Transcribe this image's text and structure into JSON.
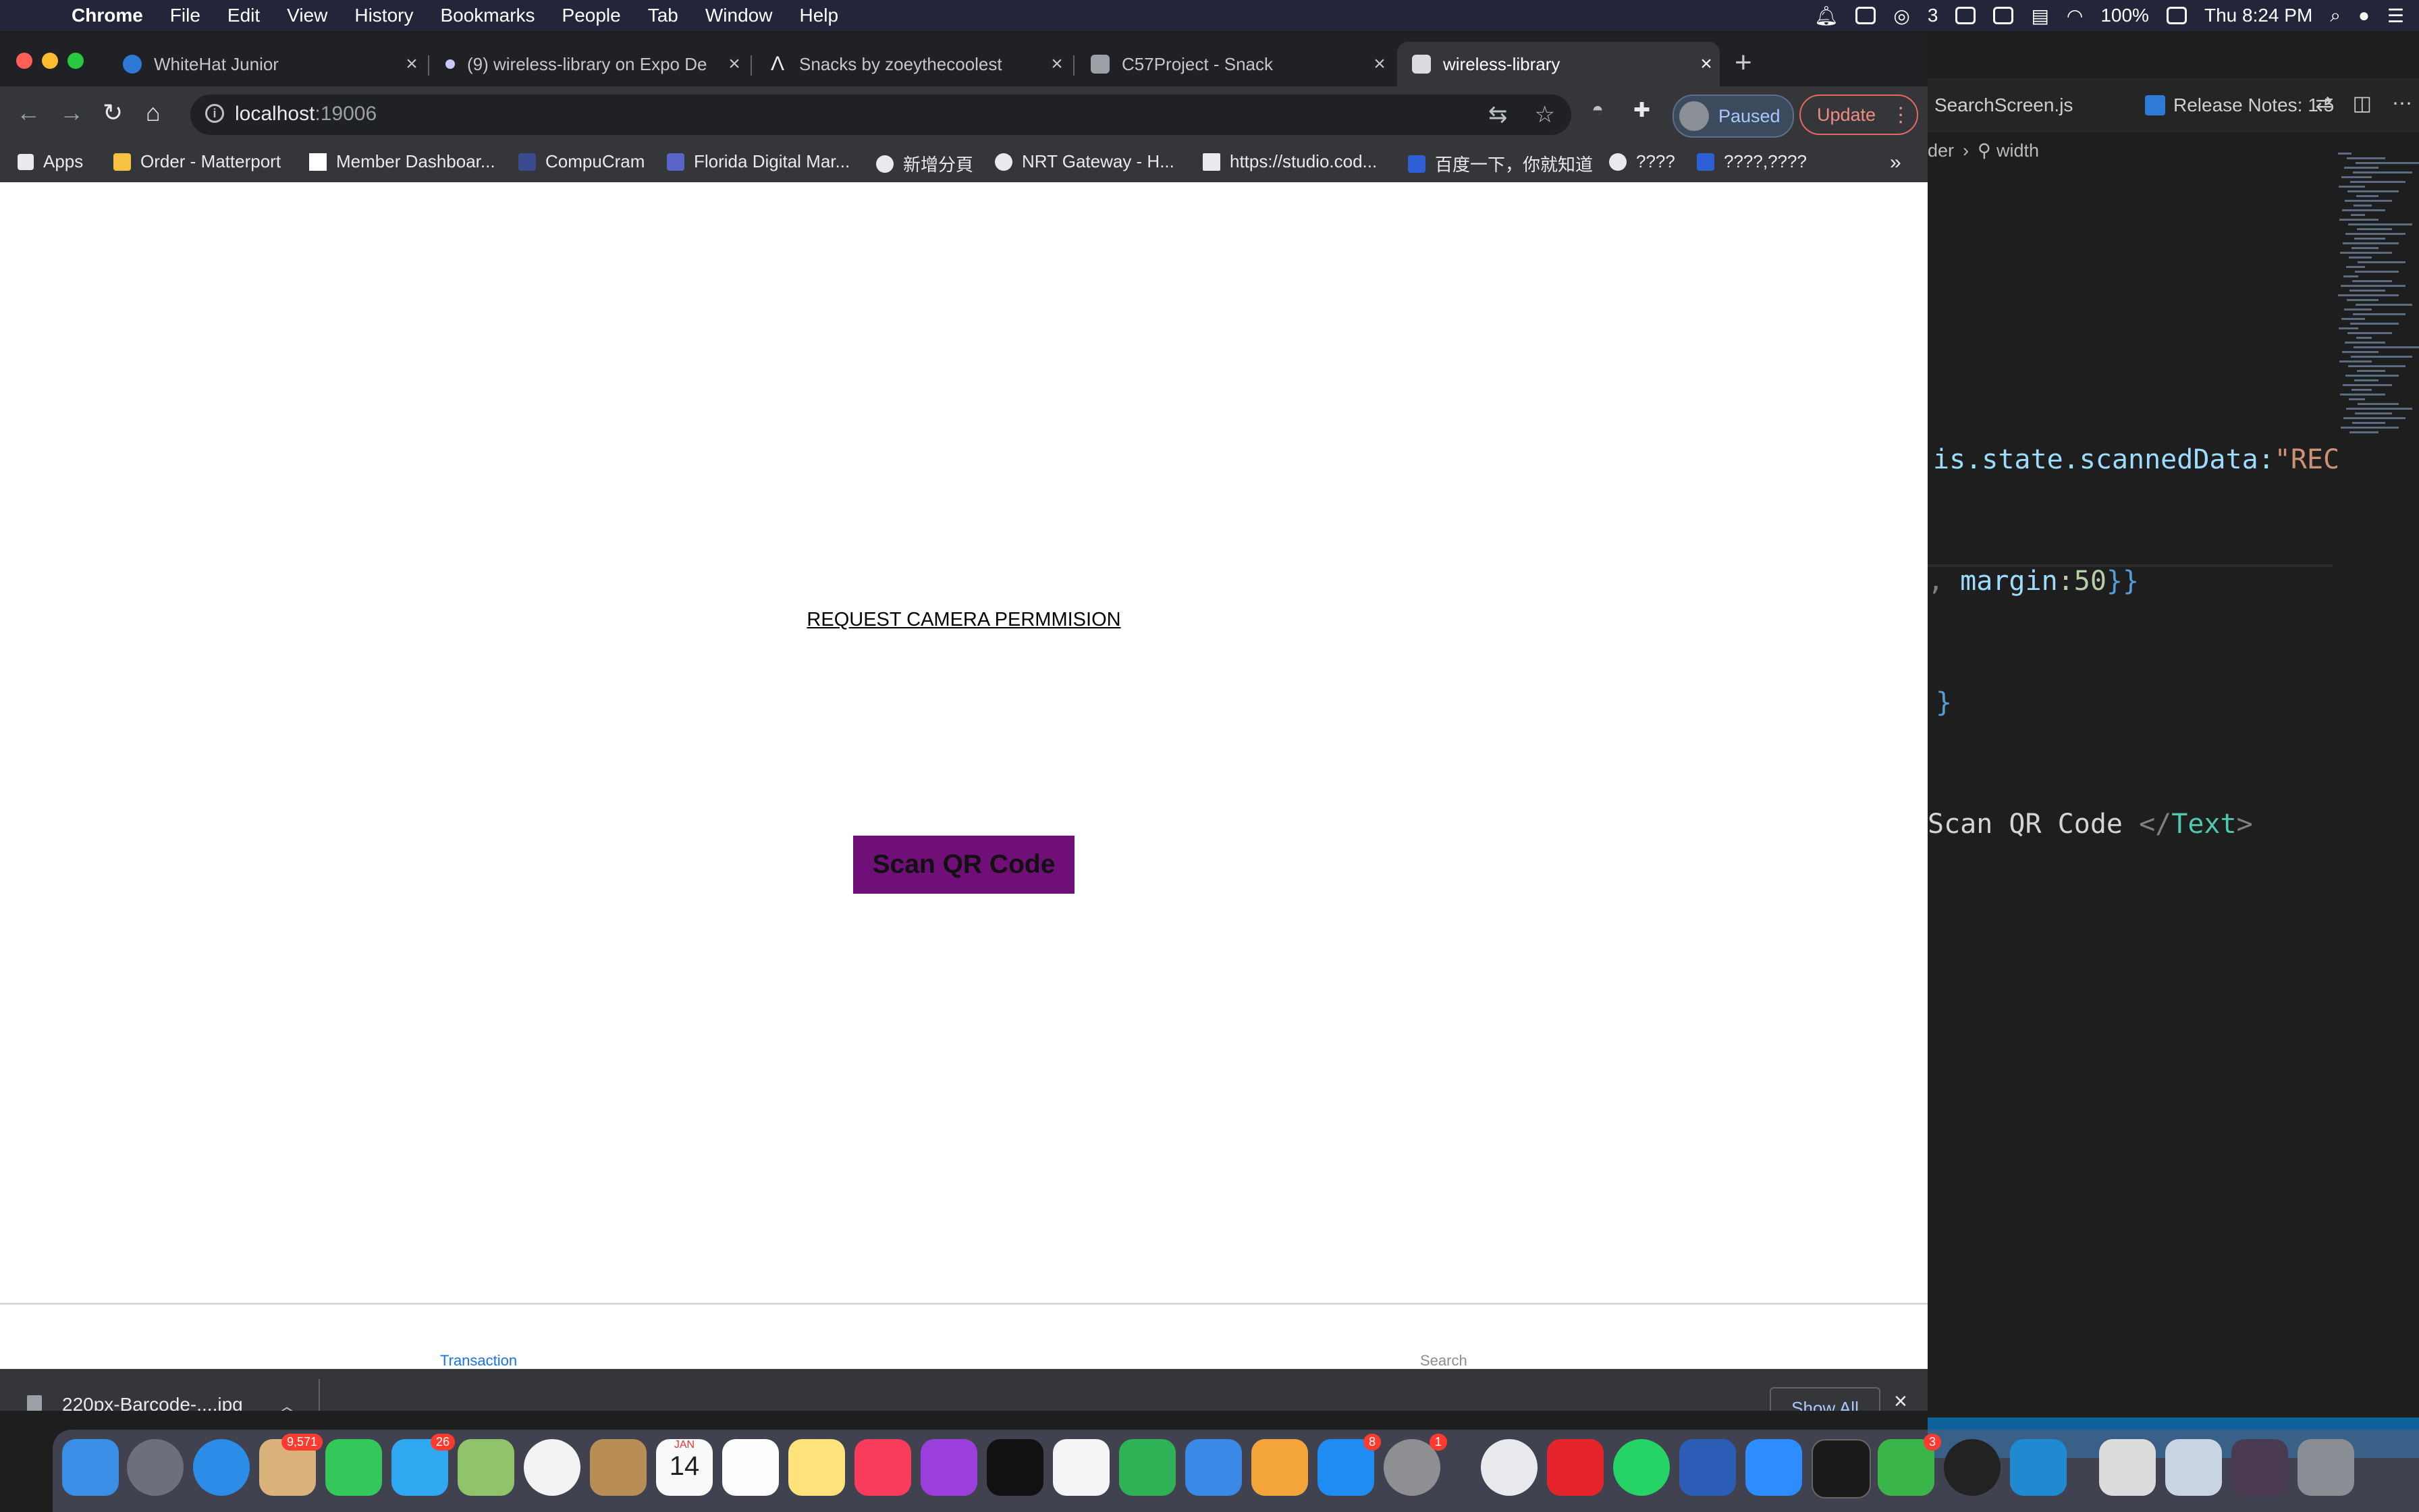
{
  "menubar": {
    "app_name": "Chrome",
    "menus": [
      "File",
      "Edit",
      "View",
      "History",
      "Bookmarks",
      "People",
      "Tab",
      "Window",
      "Help"
    ],
    "wechat_count": "3",
    "battery": "100%",
    "clock": "Thu 8:24 PM"
  },
  "tabs": [
    {
      "title": "WhiteHat Junior",
      "active": false
    },
    {
      "title": "(9) wireless-library on Expo De",
      "active": false
    },
    {
      "title": "Snacks by zoeythecoolest",
      "active": false
    },
    {
      "title": "C57Project - Snack",
      "active": false
    },
    {
      "title": "wireless-library",
      "active": true
    }
  ],
  "address_bar": {
    "host": "localhost",
    "port": ":19006"
  },
  "profile": {
    "status": "Paused"
  },
  "update_label": "Update",
  "bookmarks": [
    "Apps",
    "Order - Matterport",
    "Member Dashboar...",
    "CompuCram",
    "Florida Digital Mar...",
    "新增分頁",
    "NRT Gateway - H...",
    "https://studio.cod...",
    "百度一下，你就知道",
    "????",
    "????,????"
  ],
  "page": {
    "permission_link": "REQUEST CAMERA PERMMISION",
    "scan_button": "Scan QR Code",
    "bottom_tabs": [
      {
        "label": "Transaction",
        "active": true
      },
      {
        "label": "Search",
        "active": false
      }
    ]
  },
  "download_shelf": {
    "filename": "220px-Barcode-....jpg",
    "show_all": "Show All"
  },
  "vscode": {
    "tabs": [
      "SearchScreen.js",
      "Release Notes: 1.5"
    ],
    "breadcrumb": [
      "der",
      "width"
    ],
    "code_lines": [
      {
        "a": "is",
        "b": ".state.scannedData:",
        "c": "\"REC"
      },
      {
        "a": ", ",
        "b": "margin",
        "c": ":50",
        "d": "}}"
      },
      {
        "a": "}"
      },
      {
        "a": "Scan QR Code ",
        "b": "</",
        "c": "Text",
        "d": ">"
      }
    ]
  },
  "dock_badges": {
    "mail": "9,571",
    "messages": "26",
    "appstore": "8",
    "prefs": "1",
    "wechat": "3",
    "calendar_month": "JAN",
    "calendar_day": "14"
  },
  "colors": {
    "scan_button_bg": "#6f0f77",
    "active_tab_text": "#1a73e8"
  }
}
